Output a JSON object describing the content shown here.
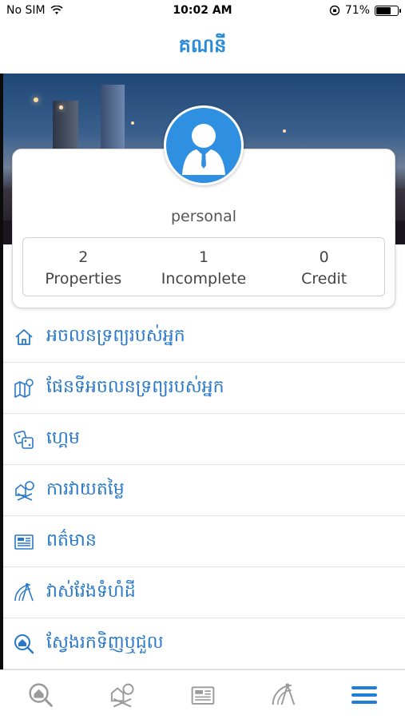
{
  "status": {
    "carrier": "No SIM",
    "time": "10:02 AM",
    "battery": "71%",
    "battery_level": 0.71
  },
  "header": {
    "title": "គណនី"
  },
  "profile": {
    "name": "personal"
  },
  "stats": [
    {
      "value": "2",
      "label": "Properties"
    },
    {
      "value": "1",
      "label": "Incomplete"
    },
    {
      "value": "0",
      "label": "Credit"
    }
  ],
  "menu": [
    {
      "label": "អចលនទ្រព្យរបស់អ្នក",
      "icon": "home-icon"
    },
    {
      "label": "ផែនទីអចលនទ្រព្យរបស់អ្នក",
      "icon": "map-icon"
    },
    {
      "label": "ហ្គេម",
      "icon": "dice-icon"
    },
    {
      "label": "ការវាយតម្លៃ",
      "icon": "valuation-icon"
    },
    {
      "label": "ពត៌មាន",
      "icon": "news-icon"
    },
    {
      "label": "វាស់វែងទំហំដី",
      "icon": "measure-icon"
    },
    {
      "label": "ស្វែងរកទិញឬជួល",
      "icon": "search-home-icon"
    }
  ],
  "tabs": [
    "search-home-icon",
    "valuation-icon",
    "news-icon",
    "measure-icon",
    "menu-icon"
  ],
  "colors": {
    "accent": "#2a8bd8",
    "tab_active": "#1f7fd6",
    "tab_inactive": "#9a9a9a"
  }
}
